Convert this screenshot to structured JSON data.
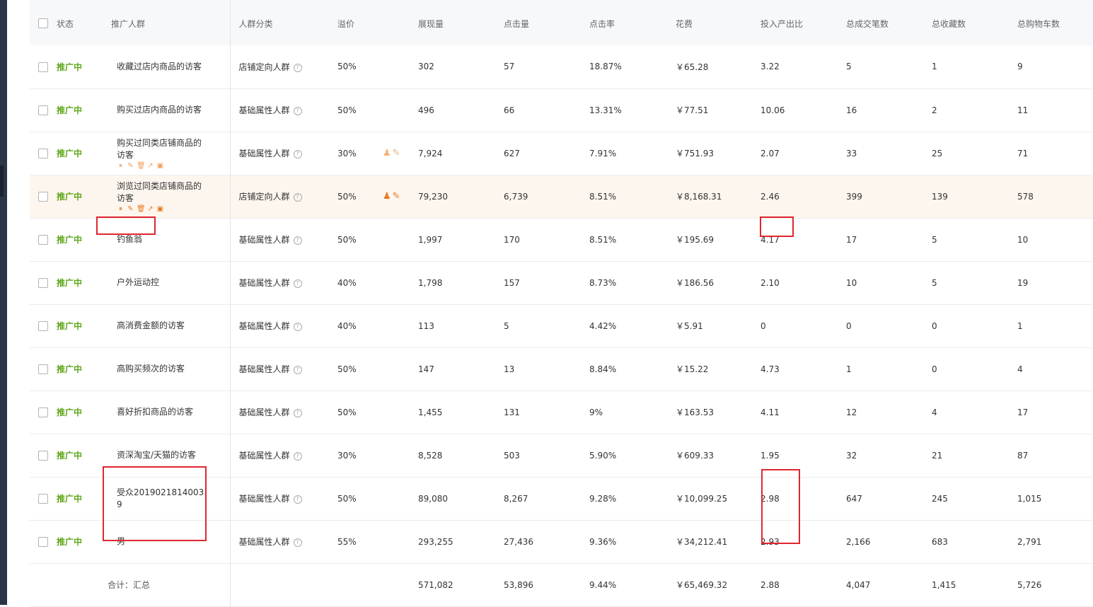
{
  "table": {
    "headers": {
      "status": "状态",
      "audience": "推广人群",
      "category": "人群分类",
      "premium": "溢价",
      "impressions": "展现量",
      "clicks": "点击量",
      "ctr": "点击率",
      "cost": "花费",
      "roi": "投入产出比",
      "orders": "总成交笔数",
      "favorites": "总收藏数",
      "cart": "总购物车数"
    },
    "rows": [
      {
        "status": "推广中",
        "name": "收藏过店内商品的访客",
        "category": "店铺定向人群",
        "premium": "50%",
        "impressions": "302",
        "clicks": "57",
        "ctr": "18.87%",
        "cost": "￥65.28",
        "roi": "3.22",
        "orders": "5",
        "favorites": "1",
        "cart": "9"
      },
      {
        "status": "推广中",
        "name": "购买过店内商品的访客",
        "category": "基础属性人群",
        "premium": "50%",
        "impressions": "496",
        "clicks": "66",
        "ctr": "13.31%",
        "cost": "￥77.51",
        "roi": "10.06",
        "orders": "16",
        "favorites": "2",
        "cart": "11"
      },
      {
        "status": "推广中",
        "name": "购买过同类店铺商品的访客",
        "category": "基础属性人群",
        "premium": "30%",
        "impressions": "7,924",
        "clicks": "627",
        "ctr": "7.91%",
        "cost": "￥751.93",
        "roi": "2.07",
        "orders": "33",
        "favorites": "25",
        "cart": "71"
      },
      {
        "status": "推广中",
        "name": "浏览过同类店铺商品的访客",
        "category": "店铺定向人群",
        "premium": "50%",
        "impressions": "79,230",
        "clicks": "6,739",
        "ctr": "8.51%",
        "cost": "￥8,168.31",
        "roi": "2.46",
        "orders": "399",
        "favorites": "139",
        "cart": "578"
      },
      {
        "status": "推广中",
        "name": "钓鱼翁",
        "category": "基础属性人群",
        "premium": "50%",
        "impressions": "1,997",
        "clicks": "170",
        "ctr": "8.51%",
        "cost": "￥195.69",
        "roi": "4.17",
        "orders": "17",
        "favorites": "5",
        "cart": "10"
      },
      {
        "status": "推广中",
        "name": "户外运动控",
        "category": "基础属性人群",
        "premium": "40%",
        "impressions": "1,798",
        "clicks": "157",
        "ctr": "8.73%",
        "cost": "￥186.56",
        "roi": "2.10",
        "orders": "10",
        "favorites": "5",
        "cart": "19"
      },
      {
        "status": "推广中",
        "name": "高消费金额的访客",
        "category": "基础属性人群",
        "premium": "40%",
        "impressions": "113",
        "clicks": "5",
        "ctr": "4.42%",
        "cost": "￥5.91",
        "roi": "0",
        "orders": "0",
        "favorites": "0",
        "cart": "1"
      },
      {
        "status": "推广中",
        "name": "高购买频次的访客",
        "category": "基础属性人群",
        "premium": "50%",
        "impressions": "147",
        "clicks": "13",
        "ctr": "8.84%",
        "cost": "￥15.22",
        "roi": "4.73",
        "orders": "1",
        "favorites": "0",
        "cart": "4"
      },
      {
        "status": "推广中",
        "name": "喜好折扣商品的访客",
        "category": "基础属性人群",
        "premium": "50%",
        "impressions": "1,455",
        "clicks": "131",
        "ctr": "9%",
        "cost": "￥163.53",
        "roi": "4.11",
        "orders": "12",
        "favorites": "4",
        "cart": "17"
      },
      {
        "status": "推广中",
        "name": "资深淘宝/天猫的访客",
        "category": "基础属性人群",
        "premium": "30%",
        "impressions": "8,528",
        "clicks": "503",
        "ctr": "5.90%",
        "cost": "￥609.33",
        "roi": "1.95",
        "orders": "32",
        "favorites": "21",
        "cart": "87"
      },
      {
        "status": "推广中",
        "name": "受众20190218140039",
        "category": "基础属性人群",
        "premium": "50%",
        "impressions": "89,080",
        "clicks": "8,267",
        "ctr": "9.28%",
        "cost": "￥10,099.25",
        "roi": "2.98",
        "orders": "647",
        "favorites": "245",
        "cart": "1,015"
      },
      {
        "status": "推广中",
        "name": "男",
        "category": "基础属性人群",
        "premium": "55%",
        "impressions": "293,255",
        "clicks": "27,436",
        "ctr": "9.36%",
        "cost": "￥34,212.41",
        "roi": "2.93",
        "orders": "2,166",
        "favorites": "683",
        "cart": "2,791"
      }
    ],
    "total": {
      "label": "合计：汇总",
      "impressions": "571,082",
      "clicks": "53,896",
      "ctr": "9.44%",
      "cost": "￥65,469.32",
      "roi": "2.88",
      "orders": "4,047",
      "favorites": "1,415",
      "cart": "5,726"
    }
  },
  "colors": {
    "status_active": "#5ea619",
    "highlight_row": "#fdf6ee",
    "annotation_red": "#e0262e",
    "icon_orange": "#e87a22"
  },
  "icons": {
    "row_actions": [
      "pause-icon",
      "edit-icon",
      "delete-icon",
      "chart-icon",
      "report-icon"
    ],
    "bid_actions": [
      "bid-user-icon",
      "pencil-icon"
    ],
    "category_help": "question-icon"
  }
}
